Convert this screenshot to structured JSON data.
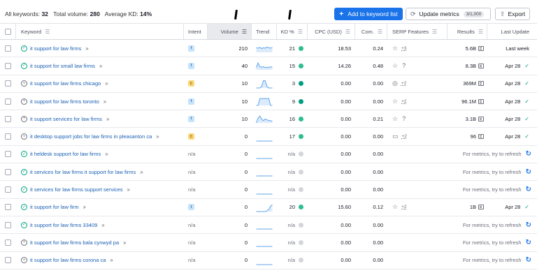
{
  "summary": {
    "all_keywords_label": "All keywords:",
    "all_keywords_value": "32",
    "total_volume_label": "Total volume:",
    "total_volume_value": "280",
    "avg_kd_label": "Average KD:",
    "avg_kd_value": "14%"
  },
  "toolbar": {
    "add_label": "Add to keyword list",
    "update_label": "Update metrics",
    "update_quota": "3/1,000",
    "export_label": "Export"
  },
  "columns": {
    "keyword": "Keyword",
    "intent": "Intent",
    "volume": "Volume",
    "trend": "Trend",
    "kd": "KD %",
    "cpc": "CPC (USD)",
    "com": "Com.",
    "serp": "SERP Features",
    "results": "Results",
    "last_update": "Last Update"
  },
  "colors": {
    "accent": "#1a73e8",
    "kd_easy": "#2fbd8f",
    "kd_very_easy": "#009f81",
    "kd_na": "#d4d6dd",
    "trend_line": "#60a5e8"
  },
  "rows": [
    {
      "status": "added",
      "keyword": "it support for law firms",
      "intent": "I",
      "volume": "210",
      "trend": [
        0.6,
        0.55,
        0.65,
        0.5,
        0.6,
        0.55,
        0.7,
        0.6,
        0.55,
        0.65
      ],
      "kd": "21",
      "kd_color": "#2fbd8f",
      "cpc": "18.53",
      "com": "0.24",
      "serp_icon": "star",
      "serp_more": "+3",
      "serp_q": false,
      "results": "5.6B",
      "update": "Last week",
      "update_check": false,
      "refresh": ""
    },
    {
      "status": "added",
      "keyword": "it support for small law firms",
      "intent": "I",
      "volume": "40",
      "trend": [
        0.3,
        0.9,
        0.4,
        0.35,
        0.4,
        0.3,
        0.35,
        0.3,
        0.4,
        0.35
      ],
      "kd": "15",
      "kd_color": "#2fbd8f",
      "cpc": "14.26",
      "com": "0.48",
      "serp_icon": "star",
      "serp_more": "",
      "serp_q": true,
      "results": "8.3B",
      "update": "Apr 28",
      "update_check": true,
      "refresh": ""
    },
    {
      "status": "plus",
      "keyword": "it support for law firms chicago",
      "intent": "C",
      "volume": "10",
      "trend": [
        0,
        0,
        0,
        0.2,
        0.95,
        0.95,
        0.2,
        0,
        0,
        0
      ],
      "kd": "3",
      "kd_color": "#009f81",
      "cpc": "0.00",
      "com": "0.00",
      "serp_icon": "pin",
      "serp_more": "+2",
      "serp_q": false,
      "results": "369M",
      "update": "Apr 28",
      "update_check": true,
      "refresh": ""
    },
    {
      "status": "plus",
      "keyword": "it support for law firms toronto",
      "intent": "I",
      "volume": "10",
      "trend": [
        0,
        0,
        0.9,
        0.9,
        0.9,
        0.9,
        0.9,
        0.9,
        0,
        0
      ],
      "kd": "9",
      "kd_color": "#009f81",
      "cpc": "0.00",
      "com": "0.00",
      "serp_icon": "star",
      "serp_more": "+2",
      "serp_q": false,
      "results": "96.1M",
      "update": "Apr 28",
      "update_check": true,
      "refresh": ""
    },
    {
      "status": "plus",
      "keyword": "it support services for law firms",
      "intent": "I",
      "volume": "10",
      "trend": [
        0,
        0.6,
        0.9,
        0.5,
        0.3,
        0.5,
        0.4,
        0.3,
        0.3,
        0.2
      ],
      "kd": "16",
      "kd_color": "#2fbd8f",
      "cpc": "0.00",
      "com": "0.21",
      "serp_icon": "star",
      "serp_more": "",
      "serp_q": true,
      "results": "3.1B",
      "update": "Apr 28",
      "update_check": true,
      "refresh": ""
    },
    {
      "status": "plus",
      "keyword": "it desktop support jobs for law firms in pleasanton ca",
      "intent": "C",
      "volume": "0",
      "trend": [
        0,
        0,
        0,
        0,
        0,
        0,
        0,
        0,
        0,
        0
      ],
      "kd": "17",
      "kd_color": "#2fbd8f",
      "cpc": "0.00",
      "com": "0.00",
      "serp_icon": "chat",
      "serp_more": "+2",
      "serp_q": false,
      "results": "96",
      "update": "Apr 28",
      "update_check": true,
      "refresh": ""
    },
    {
      "status": "added",
      "keyword": "it heldesk support for law firms",
      "intent": "",
      "volume": "0",
      "trend": [
        0,
        0,
        0,
        0,
        0,
        0,
        0,
        0,
        0,
        0
      ],
      "kd": "",
      "kd_color": "#d4d6dd",
      "cpc": "0.00",
      "com": "0.00",
      "serp_icon": "",
      "serp_more": "",
      "serp_q": false,
      "results": "",
      "update": "",
      "update_check": false,
      "refresh": "For metrics, try to refresh"
    },
    {
      "status": "added",
      "keyword": "it services for law firms it support for law firms",
      "intent": "",
      "volume": "0",
      "trend": [
        0,
        0,
        0,
        0,
        0,
        0,
        0,
        0,
        0,
        0
      ],
      "kd": "",
      "kd_color": "#d4d6dd",
      "cpc": "0.00",
      "com": "0.00",
      "serp_icon": "",
      "serp_more": "",
      "serp_q": false,
      "results": "",
      "update": "",
      "update_check": false,
      "refresh": "For metrics, try to refresh"
    },
    {
      "status": "added",
      "keyword": "it services for law firms support services",
      "intent": "",
      "volume": "0",
      "trend": [
        0,
        0,
        0,
        0,
        0,
        0,
        0,
        0,
        0,
        0
      ],
      "kd": "",
      "kd_color": "#d4d6dd",
      "cpc": "0.00",
      "com": "0.00",
      "serp_icon": "",
      "serp_more": "",
      "serp_q": false,
      "results": "",
      "update": "",
      "update_check": false,
      "refresh": "For metrics, try to refresh"
    },
    {
      "status": "added",
      "keyword": "it support for law firm",
      "intent": "I",
      "volume": "0",
      "trend": [
        0,
        0,
        0,
        0,
        0,
        0,
        0.1,
        0.3,
        0.7,
        0.9
      ],
      "kd": "20",
      "kd_color": "#2fbd8f",
      "cpc": "15.60",
      "com": "0.12",
      "serp_icon": "star",
      "serp_more": "+2",
      "serp_q": false,
      "results": "1B",
      "update": "Apr 28",
      "update_check": true,
      "refresh": ""
    },
    {
      "status": "added",
      "keyword": "it support for law firms 33409",
      "intent": "",
      "volume": "0",
      "trend": [
        0,
        0,
        0,
        0,
        0,
        0,
        0,
        0,
        0,
        0
      ],
      "kd": "",
      "kd_color": "#d4d6dd",
      "cpc": "0.00",
      "com": "0.00",
      "serp_icon": "",
      "serp_more": "",
      "serp_q": false,
      "results": "",
      "update": "",
      "update_check": false,
      "refresh": "For metrics, try to refresh"
    },
    {
      "status": "plus",
      "keyword": "it support for law firms bala cynwyd pa",
      "intent": "",
      "volume": "0",
      "trend": [
        0,
        0,
        0,
        0,
        0,
        0,
        0,
        0,
        0,
        0
      ],
      "kd": "",
      "kd_color": "#d4d6dd",
      "cpc": "0.00",
      "com": "0.00",
      "serp_icon": "",
      "serp_more": "",
      "serp_q": false,
      "results": "",
      "update": "",
      "update_check": false,
      "refresh": "For metrics, try to refresh"
    },
    {
      "status": "plus",
      "keyword": "it support for law firms corona ca",
      "intent": "",
      "volume": "0",
      "trend": [
        0,
        0,
        0,
        0,
        0,
        0,
        0,
        0,
        0,
        0
      ],
      "kd": "",
      "kd_color": "#d4d6dd",
      "cpc": "0.00",
      "com": "0.00",
      "serp_icon": "",
      "serp_more": "",
      "serp_q": false,
      "results": "",
      "update": "",
      "update_check": false,
      "refresh": "For metrics, try to refresh"
    }
  ],
  "na_text": "n/a"
}
